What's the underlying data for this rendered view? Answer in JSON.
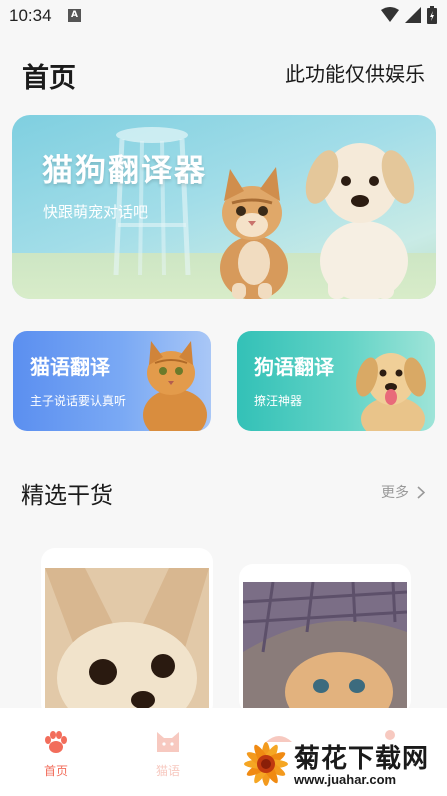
{
  "status_bar": {
    "time": "10:34",
    "notification_icon": "A"
  },
  "header": {
    "title": "首页",
    "disclaimer": "此功能仅供娱乐"
  },
  "banner": {
    "title": "猫狗翻译器",
    "subtitle": "快跟萌宠对话吧"
  },
  "features": [
    {
      "title": "猫语翻译",
      "subtitle": "主子说话要认真听",
      "icon": "cat-photo"
    },
    {
      "title": "狗语翻译",
      "subtitle": "撩汪神器",
      "icon": "dog-photo"
    }
  ],
  "section": {
    "title": "精选干货",
    "more_label": "更多"
  },
  "bottom_nav": [
    {
      "label": "首页",
      "icon": "paw-icon",
      "active": true
    },
    {
      "label": "猫语",
      "icon": "cat-face-icon",
      "active": false
    }
  ],
  "watermark": {
    "text": "菊花下载网",
    "url": "www.juahar.com"
  },
  "colors": {
    "accent": "#f26d5b",
    "cat_card": "#5b8ff0",
    "dog_card": "#33c1b7"
  }
}
